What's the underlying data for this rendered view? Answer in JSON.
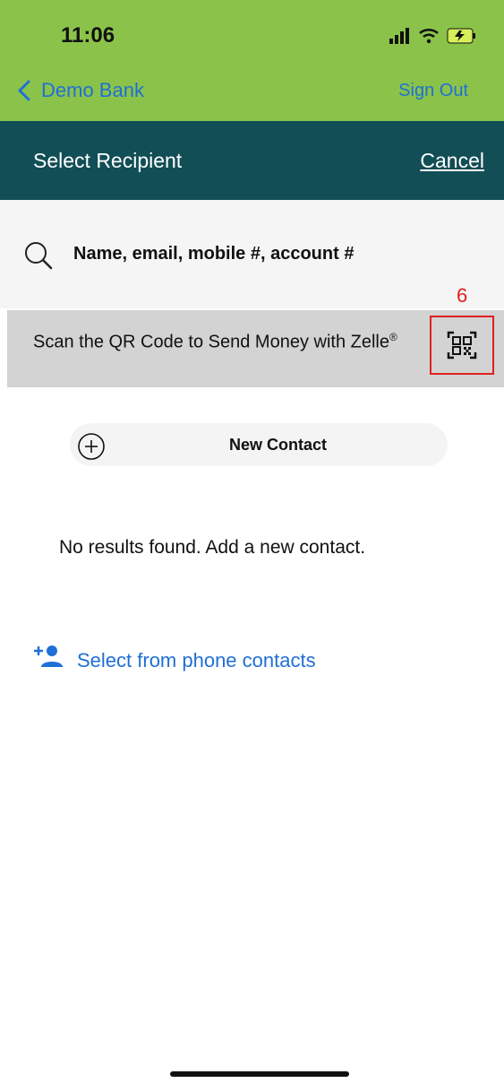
{
  "status_bar": {
    "time": "11:06"
  },
  "nav": {
    "back_label": "Demo Bank",
    "sign_out_label": "Sign Out"
  },
  "header": {
    "title": "Select Recipient",
    "cancel_label": "Cancel"
  },
  "search": {
    "placeholder": "Name, email, mobile #, account #"
  },
  "qr": {
    "text_main": "Scan the QR Code to Send Money with Zelle",
    "text_sup": "®",
    "annotation": "6"
  },
  "new_contact": {
    "label": "New Contact"
  },
  "empty_state": {
    "message": "No results found. Add a new contact."
  },
  "phone_contacts": {
    "label": "Select from phone contacts"
  },
  "colors": {
    "top_bar": "#8bc34a",
    "header_bar": "#124e56",
    "link": "#1f6fd6",
    "annotation": "#e02020"
  }
}
